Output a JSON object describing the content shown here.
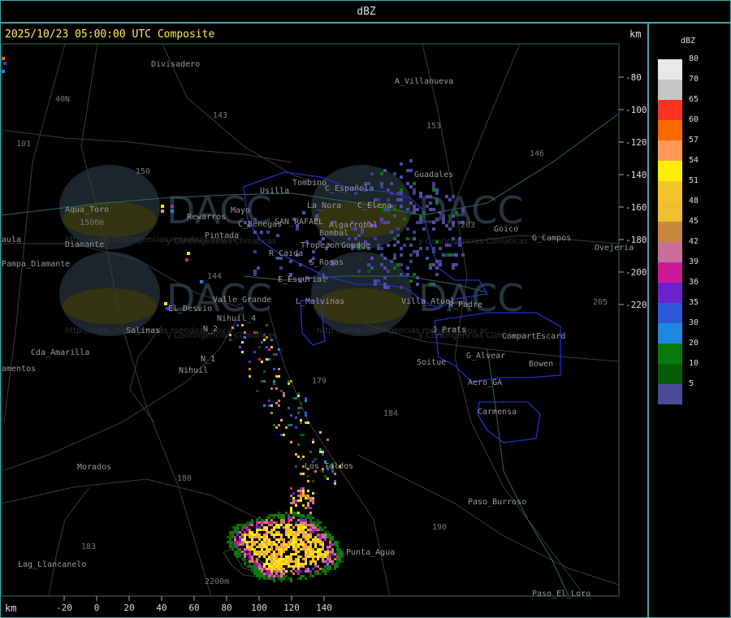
{
  "title": "dBZ",
  "timestamp": "2025/10/23 05:00:00 UTC Composite",
  "units": {
    "top": "km",
    "bottom": "km"
  },
  "legend": {
    "title": "dBZ",
    "entries": [
      {
        "label": "80",
        "color": "#e8e8e8"
      },
      {
        "label": "70",
        "color": "#c4c4c4"
      },
      {
        "label": "65",
        "color": "#ff3322"
      },
      {
        "label": "60",
        "color": "#ff6a00"
      },
      {
        "label": "57",
        "color": "#ff9a55"
      },
      {
        "label": "54",
        "color": "#ffee00"
      },
      {
        "label": "51",
        "color": "#f5c42a"
      },
      {
        "label": "48",
        "color": "#f0bf30"
      },
      {
        "label": "45",
        "color": "#c8883e"
      },
      {
        "label": "42",
        "color": "#c8709a"
      },
      {
        "label": "39",
        "color": "#cc1a96"
      },
      {
        "label": "36",
        "color": "#6a22cc"
      },
      {
        "label": "35",
        "color": "#2b5ad8"
      },
      {
        "label": "30",
        "color": "#1e88e0"
      },
      {
        "label": "20",
        "color": "#0a7a0a"
      },
      {
        "label": "10",
        "color": "#065c06"
      },
      {
        "label": "5",
        "color": "#4a4a9a"
      }
    ]
  },
  "x_ticks": [
    "-20",
    "0",
    "20",
    "40",
    "60",
    "80",
    "100",
    "120",
    "140"
  ],
  "y_ticks": [
    "-80",
    "-100",
    "-120",
    "-140",
    "-160",
    "-180",
    "-200",
    "-220"
  ],
  "watermark": {
    "brand": "DACC",
    "subtitle": "Direccion de Agricultura y Contingencias Climaticas",
    "subtitle_short": "y Contingencias Climaticas",
    "url": "http://www.contingencias.mendoza.gov.ar"
  },
  "places": [
    {
      "name": "Divisadero"
    },
    {
      "name": "A_Villanueva"
    },
    {
      "name": "Guadales"
    },
    {
      "name": "Tombino"
    },
    {
      "name": "Usilla"
    },
    {
      "name": "C_Española"
    },
    {
      "name": "La_Nora"
    },
    {
      "name": "C_Elena"
    },
    {
      "name": "Aqua_Toro"
    },
    {
      "name": "Rewarros"
    },
    {
      "name": "Mayo"
    },
    {
      "name": "C_Benegas"
    },
    {
      "name": "SAN_RAFAEL"
    },
    {
      "name": "Algarrobal"
    },
    {
      "name": "Bombal"
    },
    {
      "name": "Pintada"
    },
    {
      "name": "Tropezon"
    },
    {
      "name": "Goudge"
    },
    {
      "name": "R_Caida"
    },
    {
      "name": "S_Rosas"
    },
    {
      "name": "Goico"
    },
    {
      "name": "G_Campos"
    },
    {
      "name": "Ovejeria"
    },
    {
      "name": "aula"
    },
    {
      "name": "Pampa_Diamante"
    },
    {
      "name": "Diamante"
    },
    {
      "name": "E_Escurial"
    },
    {
      "name": "Valle_Grande"
    },
    {
      "name": "L_Malvinas"
    },
    {
      "name": "El_Desvio"
    },
    {
      "name": "Villa_Atuel"
    },
    {
      "name": "R_Padre"
    },
    {
      "name": "J_Prats"
    },
    {
      "name": "CompartEscard"
    },
    {
      "name": "Salinas"
    },
    {
      "name": "N_2"
    },
    {
      "name": "N_1"
    },
    {
      "name": "Nihuil"
    },
    {
      "name": "Cda_Amarilla"
    },
    {
      "name": "amentos"
    },
    {
      "name": "G_Alvear"
    },
    {
      "name": "Soitue"
    },
    {
      "name": "Bowen"
    },
    {
      "name": "Aero_GA"
    },
    {
      "name": "Carmensa"
    },
    {
      "name": "Los_Toldos"
    },
    {
      "name": "Morados"
    },
    {
      "name": "Paso_Burroso"
    },
    {
      "name": "Punta_Agua"
    },
    {
      "name": "Lag_Llancanelo"
    },
    {
      "name": "Paso_El_Loro"
    },
    {
      "name": "Nihuil_4"
    }
  ],
  "roads": [
    {
      "name": "143"
    },
    {
      "name": "153"
    },
    {
      "name": "146"
    },
    {
      "name": "40N"
    },
    {
      "name": "101"
    },
    {
      "name": "150"
    },
    {
      "name": "144"
    },
    {
      "name": "203"
    },
    {
      "name": "205"
    },
    {
      "name": "179"
    },
    {
      "name": "184"
    },
    {
      "name": "180"
    },
    {
      "name": "190"
    },
    {
      "name": "183"
    },
    {
      "name": "1500m"
    },
    {
      "name": "2200m"
    }
  ]
}
